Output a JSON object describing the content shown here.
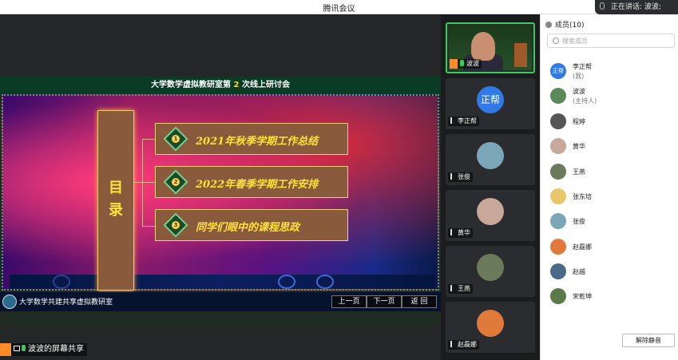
{
  "window": {
    "title": "腾讯会议"
  },
  "speaking": {
    "label": "正在讲话: 波波;"
  },
  "share": {
    "header_prefix": "大学数学虚拟教研室第",
    "header_num": "2",
    "header_suffix": "次线上研讨会",
    "toc_title_1": "目",
    "toc_title_2": "录",
    "items": [
      {
        "num": "1",
        "label": "2021年秋季学期工作总结"
      },
      {
        "num": "2",
        "label": "2022年春季学期工作安排"
      },
      {
        "num": "3",
        "label": "同学们眼中的课程思政"
      }
    ],
    "org": "大学数学共建共享虚拟教研室",
    "nav": {
      "prev": "上一页",
      "next": "下一页",
      "back": "返  回"
    },
    "screen_label": "波波的屏幕共享"
  },
  "videos": [
    {
      "name": "波波",
      "type": "camera",
      "host": true,
      "mic": "on"
    },
    {
      "name": "李正帮",
      "type": "text",
      "avatar_text": "正帮",
      "mic": "muted"
    },
    {
      "name": "张俊",
      "type": "image",
      "color": "#7aa6b8",
      "mic": "muted"
    },
    {
      "name": "黄华",
      "type": "image",
      "color": "#c8a89a",
      "mic": "muted"
    },
    {
      "name": "王燕",
      "type": "image",
      "color": "#6a7a5a",
      "mic": "muted"
    },
    {
      "name": "赵磊娜",
      "type": "image",
      "color": "#e07a3a",
      "mic": "muted"
    }
  ],
  "members": {
    "title": "成员(10)",
    "search_placeholder": "搜索成员",
    "list": [
      {
        "name": "李正帮",
        "sub": "(我)",
        "avatar_text": "正帮",
        "color": "#2f7ae5"
      },
      {
        "name": "波波",
        "sub": "(主持人)",
        "color": "#5a8a5a"
      },
      {
        "name": "程婷",
        "sub": "",
        "color": "#555555"
      },
      {
        "name": "黄华",
        "sub": "",
        "color": "#c8a89a"
      },
      {
        "name": "王燕",
        "sub": "",
        "color": "#6a7a5a"
      },
      {
        "name": "张东培",
        "sub": "",
        "color": "#e8c86a"
      },
      {
        "name": "张俊",
        "sub": "",
        "color": "#7aa6b8"
      },
      {
        "name": "赵磊娜",
        "sub": "",
        "color": "#e07a3a"
      },
      {
        "name": "赵越",
        "sub": "",
        "color": "#4a6a8a"
      },
      {
        "name": "宋乾坤",
        "sub": "",
        "color": "#5a7a4a"
      }
    ],
    "unmute_label": "解除静音"
  }
}
